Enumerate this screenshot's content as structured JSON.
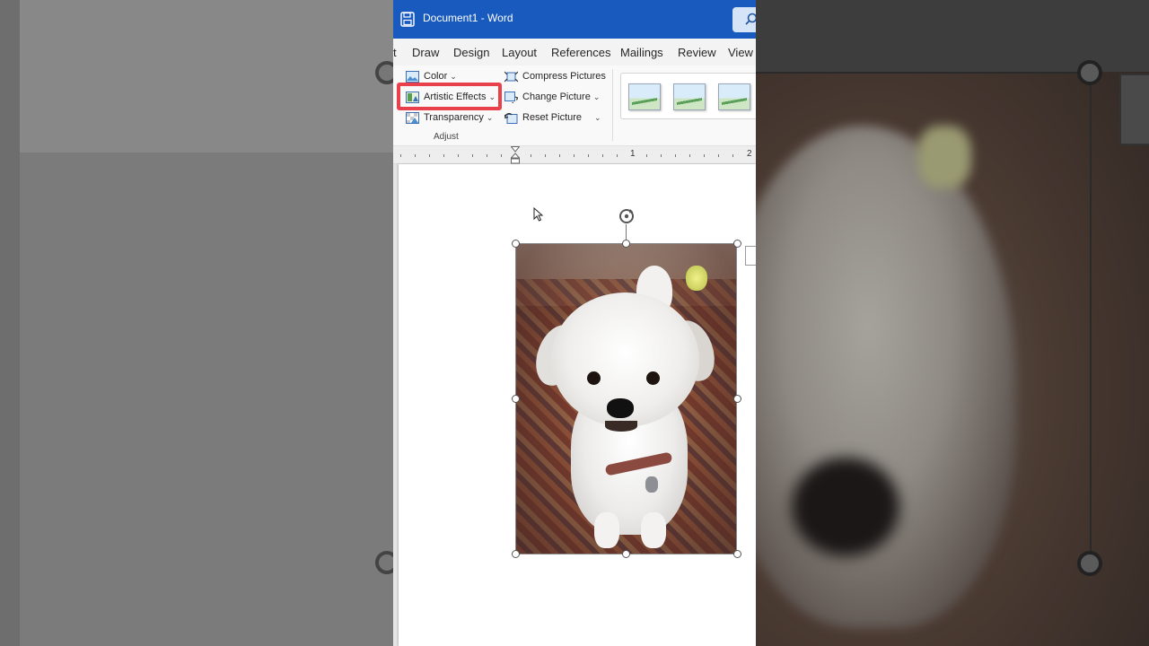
{
  "window": {
    "doc_name": "Document1",
    "separator": " - ",
    "app_name": "Word"
  },
  "tabs": [
    "t",
    "Draw",
    "Design",
    "Layout",
    "References",
    "Mailings",
    "Review",
    "View"
  ],
  "ribbon": {
    "adjust": {
      "color_label": "Color",
      "artistic_effects_label": "Artistic Effects",
      "transparency_label": "Transparency",
      "compress_pictures_label": "Compress Pictures",
      "change_picture_label": "Change Picture",
      "reset_picture_label": "Reset Picture",
      "group_label": "Adjust"
    },
    "highlighted_control": "Artistic Effects",
    "highlight_color": "#e8414b"
  },
  "ruler": {
    "numbers": [
      "1",
      "2"
    ]
  },
  "colors": {
    "titlebar": "#185abd",
    "tab_bar": "#f3f3f3",
    "ribbon": "#f9f9f9"
  },
  "icons": {
    "save": "save-icon",
    "search": "search-icon",
    "rotate": "rotate-handle-icon",
    "pointer": "mouse-pointer-icon",
    "layout_options": "layout-options-icon"
  }
}
